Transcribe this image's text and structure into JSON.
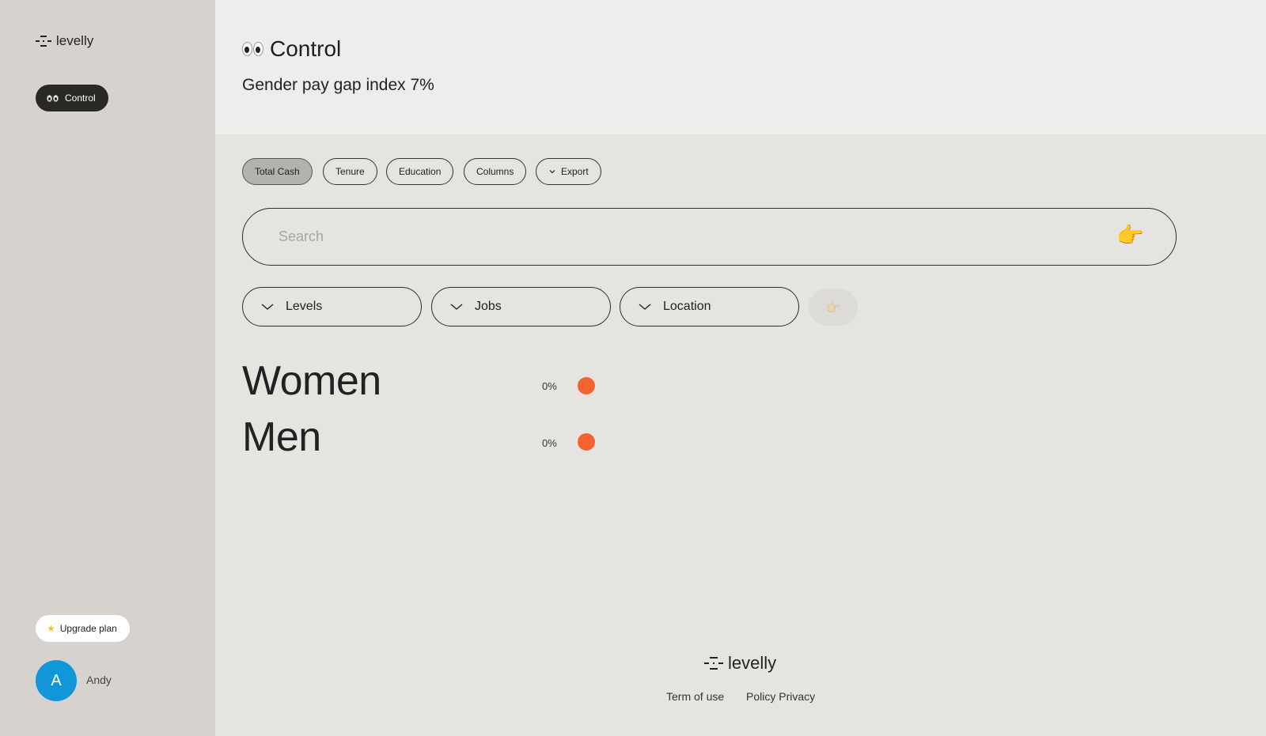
{
  "sidebar": {
    "brand": "levelly",
    "nav": {
      "control_label": "Control"
    },
    "upgrade_label": "Upgrade plan",
    "user": {
      "initial": "A",
      "name": "Andy"
    }
  },
  "header": {
    "title": "Control",
    "subtitle": "Gender pay gap index 7%"
  },
  "toolbar": {
    "chips": [
      {
        "label": "Total Cash",
        "active": true
      },
      {
        "label": "Tenure"
      },
      {
        "label": "Education"
      },
      {
        "label": "Columns"
      },
      {
        "label": "Export",
        "icon": "chevron-down-icon"
      }
    ]
  },
  "search": {
    "placeholder": "Search",
    "value": "",
    "icon": "pointing-hand-icon"
  },
  "filters": {
    "dropdowns": [
      {
        "label": "Levels"
      },
      {
        "label": "Jobs"
      },
      {
        "label": "Location"
      }
    ],
    "apply_icon": "pointing-hand-icon",
    "apply_disabled": true
  },
  "results": {
    "rows": [
      {
        "label": "Women",
        "value": "0%"
      },
      {
        "label": "Men",
        "value": "0%"
      }
    ]
  },
  "footer": {
    "brand": "levelly",
    "links": [
      "Term of use",
      "Policy Privacy"
    ]
  },
  "colors": {
    "accent_dot": "#f4632f",
    "avatar": "#1197d8",
    "nav_active_bg": "#2b2926"
  }
}
